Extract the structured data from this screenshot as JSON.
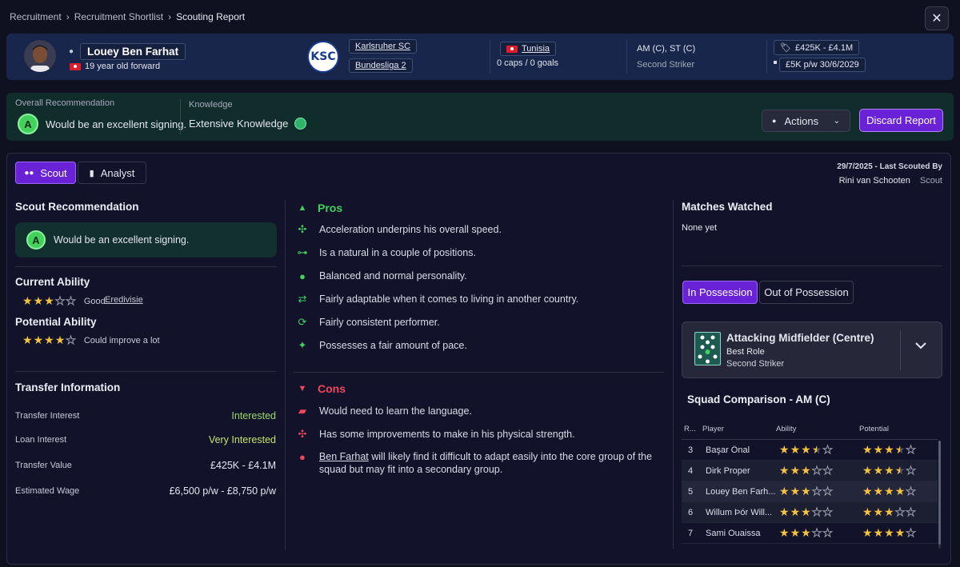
{
  "breadcrumb": {
    "items": [
      "Recruitment",
      "Recruitment Shortlist"
    ],
    "current": "Scouting Report"
  },
  "player": {
    "name": "Louey Ben Farhat",
    "age_position": "19 year old forward",
    "club": "Karlsruher SC",
    "club_badge": "KSC",
    "league": "Bundesliga 2",
    "nation": "Tunisia",
    "caps_goals": "0 caps / 0 goals",
    "positions": "AM (C), ST (C)",
    "role": "Second Striker",
    "value": "£425K - £4.1M",
    "wage_contract": "£5K p/w  30/6/2029"
  },
  "overall": {
    "label": "Overall Recommendation",
    "grade": "A",
    "text": "Would be an excellent signing.",
    "knowledge_label": "Knowledge",
    "knowledge_text": "Extensive Knowledge"
  },
  "buttons": {
    "actions": "Actions",
    "discard": "Discard Report",
    "close": "✕"
  },
  "tabs": {
    "scout": "Scout",
    "analyst": "Analyst"
  },
  "scouted": {
    "date_line": "29/7/2025 - Last Scouted By",
    "scout_name": "Rini van Schooten",
    "scout_role": "Scout"
  },
  "scout_rec": {
    "title": "Scout Recommendation",
    "grade": "A",
    "text": "Would be an excellent signing."
  },
  "ability": {
    "current_title": "Current Ability",
    "current_stars": 3,
    "current_text": "Good",
    "current_league": "Eredivisie",
    "potential_title": "Potential Ability",
    "potential_stars": 4,
    "potential_text": "Could improve a lot"
  },
  "transfer": {
    "title": "Transfer Information",
    "rows": [
      {
        "label": "Transfer Interest",
        "value": "Interested"
      },
      {
        "label": "Loan Interest",
        "value": "Very Interested"
      },
      {
        "label": "Transfer Value",
        "value": "£425K - £4.1M"
      },
      {
        "label": "Estimated Wage",
        "value": "£6,500 p/w - £8,750 p/w"
      }
    ]
  },
  "pros": {
    "title": "Pros",
    "items": [
      {
        "icon": "acceleration-icon",
        "text": "Acceleration underpins his overall speed."
      },
      {
        "icon": "positions-icon",
        "text": "Is a natural in a couple of positions."
      },
      {
        "icon": "personality-icon",
        "text": "Balanced and normal personality."
      },
      {
        "icon": "adaptability-icon",
        "text": "Fairly adaptable when it comes to living in another country."
      },
      {
        "icon": "consistency-icon",
        "text": "Fairly consistent performer."
      },
      {
        "icon": "pace-icon",
        "text": "Possesses a fair amount of pace."
      }
    ]
  },
  "cons": {
    "title": "Cons",
    "items": [
      {
        "icon": "language-icon",
        "text": "Would need to learn the language."
      },
      {
        "icon": "strength-icon",
        "text": "Has some improvements to make in his physical strength."
      },
      {
        "icon": "social-group-icon",
        "name_link": "Ben Farhat",
        "text": " will likely find it difficult to adapt easily into the core group of the squad but may fit into a secondary group."
      }
    ]
  },
  "matches": {
    "title": "Matches Watched",
    "text": "None yet"
  },
  "possession": {
    "in": "In Possession",
    "out": "Out of Possession"
  },
  "role_card": {
    "title": "Attacking Midfielder (Centre)",
    "sub1": "Best Role",
    "sub2": "Second Striker"
  },
  "squad": {
    "title": "Squad Comparison - AM (C)",
    "headers": [
      "R...",
      "Player",
      "Ability",
      "Potential"
    ],
    "rows": [
      {
        "rank": "3",
        "player": "Başar Önal",
        "ability": 3.5,
        "potential": 3.5
      },
      {
        "rank": "4",
        "player": "Dirk Proper",
        "ability": 3,
        "potential": 3.5
      },
      {
        "rank": "5",
        "player": "Louey Ben Farh...",
        "ability": 3,
        "potential": 4
      },
      {
        "rank": "6",
        "player": "Willum Þór Will...",
        "ability": 3,
        "potential": 3
      },
      {
        "rank": "7",
        "player": "Sami Ouaissa",
        "ability": 3,
        "potential": 4
      }
    ]
  },
  "colors": {
    "accent": "#6a22d6",
    "grade": "#43d15e",
    "pros": "#43d15e",
    "cons": "#f0465a",
    "star": "#f5c242"
  }
}
